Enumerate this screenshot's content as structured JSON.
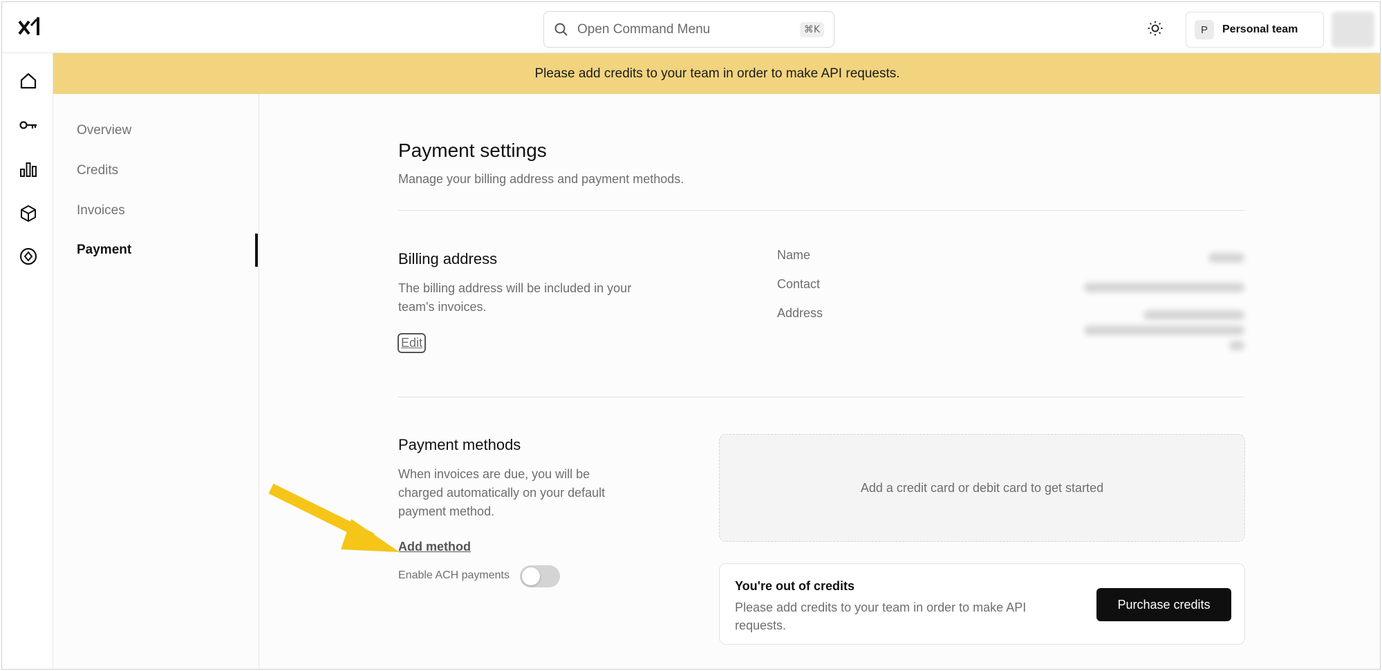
{
  "topbar": {
    "logo_icon": "xai-logo-icon",
    "command_menu": {
      "placeholder": "Open Command Menu",
      "shortcut": "⌘K"
    },
    "theme_icon": "sun-icon",
    "team": {
      "initial": "P",
      "name": "Personal team"
    }
  },
  "rail": {
    "items": [
      "home-icon",
      "key-icon",
      "bar-chart-icon",
      "cube-icon",
      "compass-icon"
    ]
  },
  "banner": {
    "text": "Please add credits to your team in order to make API requests.",
    "color": "#f2d47f"
  },
  "subnav": {
    "items": [
      {
        "label": "Overview",
        "active": false
      },
      {
        "label": "Credits",
        "active": false
      },
      {
        "label": "Invoices",
        "active": false
      },
      {
        "label": "Payment",
        "active": true
      }
    ]
  },
  "page": {
    "title": "Payment settings",
    "subtitle": "Manage your billing address and payment methods."
  },
  "billing": {
    "title": "Billing address",
    "description": "The billing address will be included in your team's invoices.",
    "edit_label": "Edit",
    "fields": {
      "name_label": "Name",
      "contact_label": "Contact",
      "address_label": "Address"
    }
  },
  "payment_methods": {
    "title": "Payment methods",
    "description": "When invoices are due, you will be charged automatically on your default payment method.",
    "add_label": "Add method",
    "ach_label": "Enable ACH payments",
    "ach_enabled": false,
    "empty_text": "Add a credit card or debit card to get started"
  },
  "credits_notice": {
    "title": "You're out of credits",
    "text": "Please add credits to your team in order to make API requests.",
    "button_label": "Purchase credits"
  },
  "annotation": {
    "arrow_color": "#f5c518"
  }
}
